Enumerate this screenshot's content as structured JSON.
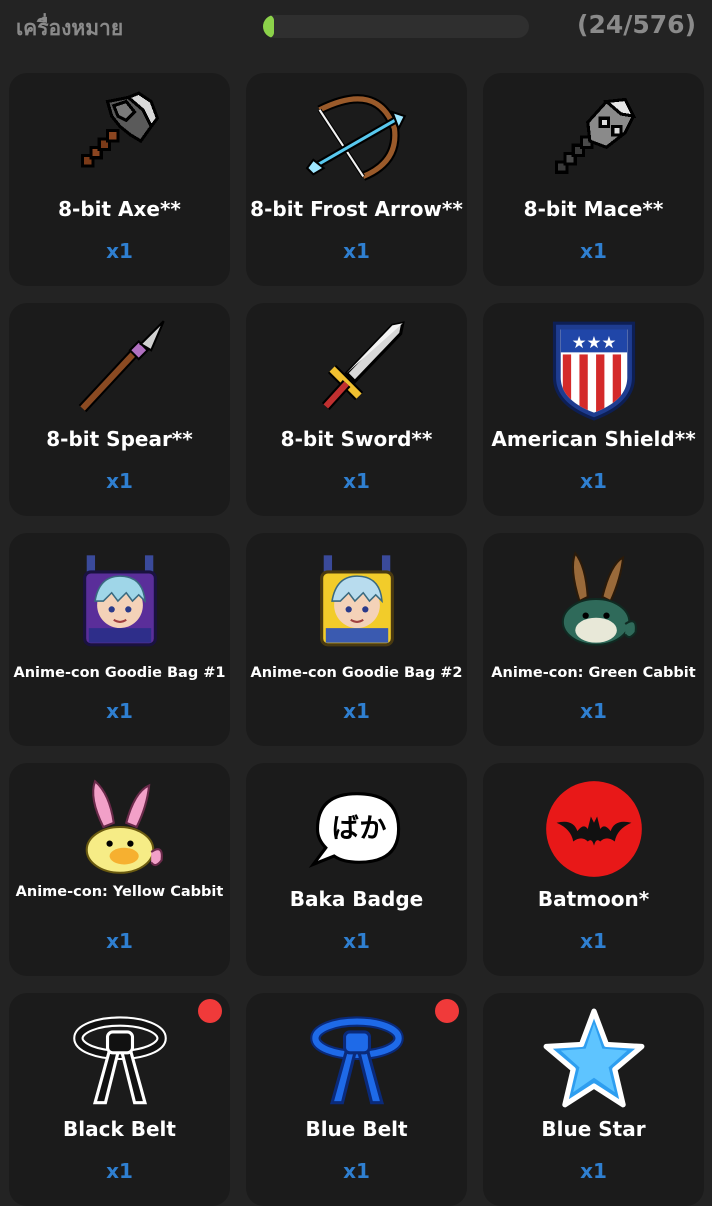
{
  "header": {
    "title": "เครื่องหมาย",
    "progress_count": "(24/576)",
    "progress_fraction": 0.0417
  },
  "items": [
    {
      "name": "8-bit Axe**",
      "qty": "x1"
    },
    {
      "name": "8-bit Frost Arrow**",
      "qty": "x1"
    },
    {
      "name": "8-bit Mace**",
      "qty": "x1"
    },
    {
      "name": "8-bit Spear**",
      "qty": "x1"
    },
    {
      "name": "8-bit Sword**",
      "qty": "x1"
    },
    {
      "name": "American Shield**",
      "qty": "x1"
    },
    {
      "name": "Anime-con Goodie Bag #1",
      "qty": "x1"
    },
    {
      "name": "Anime-con Goodie Bag #2",
      "qty": "x1"
    },
    {
      "name": "Anime-con: Green Cabbit",
      "qty": "x1"
    },
    {
      "name": "Anime-con: Yellow Cabbit",
      "qty": "x1"
    },
    {
      "name": "Baka Badge",
      "qty": "x1",
      "badge_text": "ばか"
    },
    {
      "name": "Batmoon*",
      "qty": "x1"
    },
    {
      "name": "Black Belt",
      "qty": "x1",
      "new": true
    },
    {
      "name": "Blue Belt",
      "qty": "x1",
      "new": true
    },
    {
      "name": "Blue Star",
      "qty": "x1"
    }
  ],
  "colors": {
    "background": "#232323",
    "card": "#1b1b1b",
    "progress": "#8cd24a",
    "quantity": "#2f7fd0",
    "new_dot": "#f03a3a"
  },
  "icons": [
    "8bit-axe-icon",
    "8bit-frost-arrow-icon",
    "8bit-mace-icon",
    "8bit-spear-icon",
    "8bit-sword-icon",
    "american-shield-icon",
    "goodie-bag-1-icon",
    "goodie-bag-2-icon",
    "green-cabbit-icon",
    "yellow-cabbit-icon",
    "baka-badge-icon",
    "batmoon-icon",
    "black-belt-icon",
    "blue-belt-icon",
    "blue-star-icon"
  ]
}
